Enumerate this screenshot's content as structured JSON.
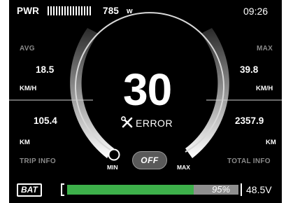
{
  "top_bar": {
    "power_label": "PWR",
    "power_value": "785",
    "power_unit": "w",
    "time": "09:26"
  },
  "left": {
    "avg_label": "AVG",
    "avg_speed": "18.5",
    "speed_unit": "KM/H",
    "trip_distance": "105.4",
    "distance_unit": "KM",
    "section_label": "TRIP INFO"
  },
  "right": {
    "max_label": "MAX",
    "max_speed": "39.8",
    "speed_unit": "KM/H",
    "total_distance": "2357.9",
    "distance_unit": "KM",
    "section_label": "TOTAL INFO"
  },
  "center": {
    "speed": "30",
    "status_text": "ERROR",
    "status_icon": "wrench-screwdriver-icon",
    "min_label": "MIN",
    "max_label": "MAX",
    "off_button": "OFF",
    "speed_dial_level": 0.0
  },
  "battery": {
    "label": "BAT",
    "percent_text": "95%",
    "percent": 0.95,
    "voltage": "48.5V"
  },
  "colors": {
    "screen_bg": "#000000",
    "battery_fill": "#3db04a",
    "muted_text": "#8a8a8a"
  }
}
